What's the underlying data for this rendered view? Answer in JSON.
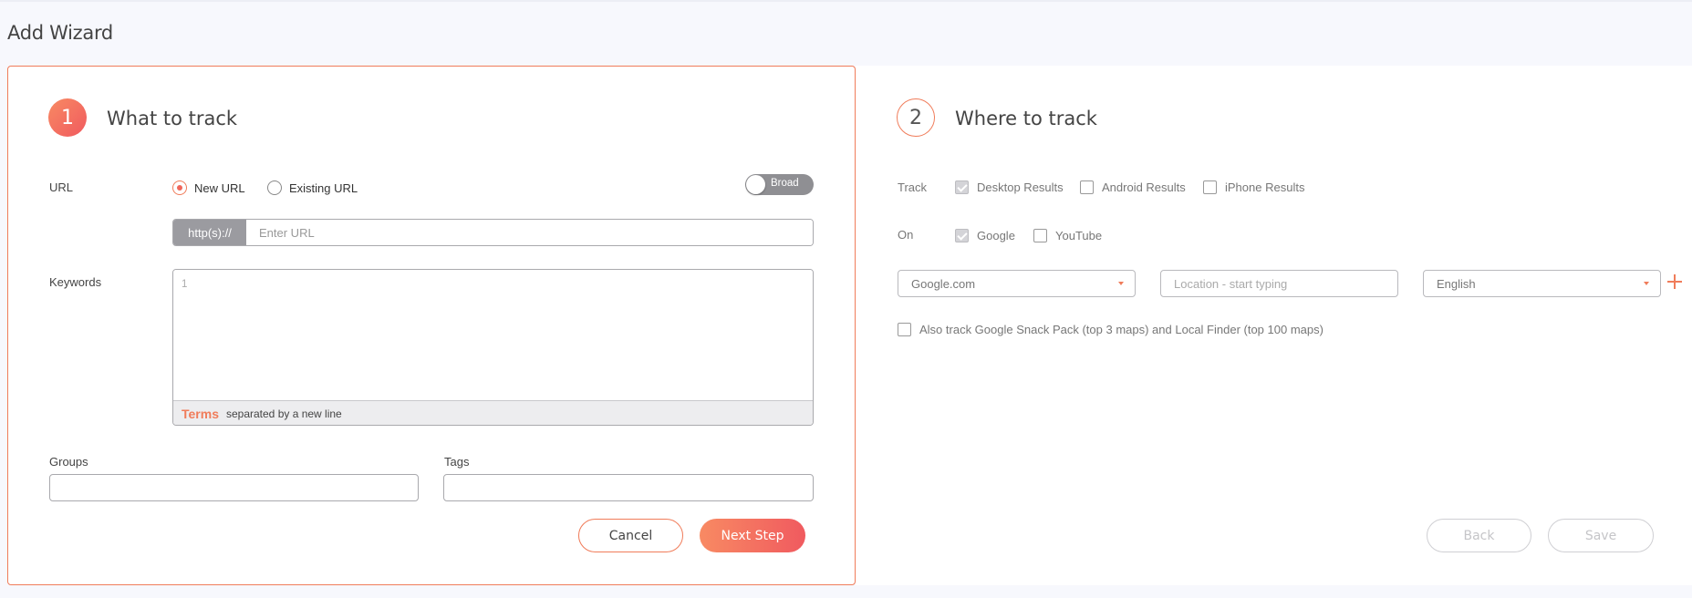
{
  "page": {
    "title": "Add Wizard"
  },
  "step1": {
    "number": "1",
    "title": "What to track",
    "url_label": "URL",
    "radio_new": "New URL",
    "radio_existing": "Existing URL",
    "url_mode_selected": "New URL",
    "toggle_label": "Broad",
    "url_prefix": "http(s)://",
    "url_placeholder": "Enter URL",
    "url_value": "",
    "keywords_label": "Keywords",
    "keywords_line_number": "1",
    "keywords_terms": "Terms",
    "keywords_hint": "separated by a new line",
    "groups_label": "Groups",
    "tags_label": "Tags",
    "cancel_label": "Cancel",
    "next_label": "Next Step"
  },
  "step2": {
    "number": "2",
    "title": "Where to track",
    "track_label": "Track",
    "track_options": [
      {
        "label": "Desktop Results",
        "checked": true
      },
      {
        "label": "Android Results",
        "checked": false
      },
      {
        "label": "iPhone Results",
        "checked": false
      }
    ],
    "on_label": "On",
    "on_options": [
      {
        "label": "Google",
        "checked": true
      },
      {
        "label": "YouTube",
        "checked": false
      }
    ],
    "search_engine_value": "Google.com",
    "location_placeholder": "Location - start typing",
    "language_value": "English",
    "snack_pack_label": "Also track Google Snack Pack (top 3 maps) and Local Finder (top 100 maps)",
    "snack_pack_checked": false,
    "back_label": "Back",
    "save_label": "Save"
  },
  "colors": {
    "accent": "#f07c5a",
    "accent_gradient_end": "#f05a5f",
    "toggle_bg": "#8f8f93",
    "prefix_bg": "#9b9ba0"
  }
}
